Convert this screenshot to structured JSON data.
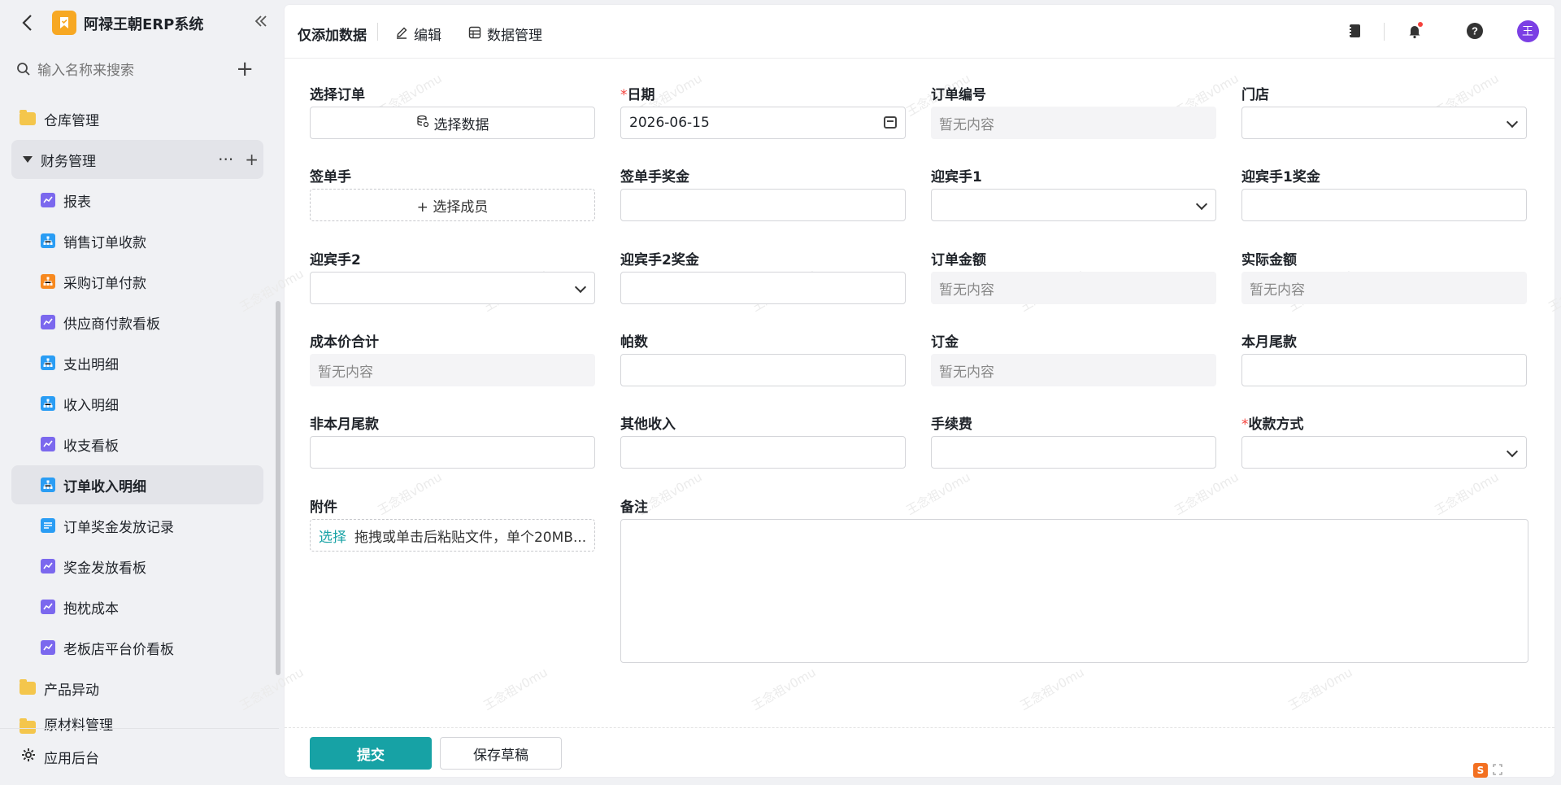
{
  "app": {
    "title": "阿禄王朝ERP系统"
  },
  "sidebar": {
    "search_placeholder": "输入名称来搜索",
    "items": [
      {
        "label": "仓库管理",
        "kind": "folder"
      },
      {
        "label": "财务管理",
        "kind": "group-open"
      },
      {
        "label": "报表",
        "kind": "chart"
      },
      {
        "label": "销售订单收款",
        "kind": "tree-blue"
      },
      {
        "label": "采购订单付款",
        "kind": "tree-orange"
      },
      {
        "label": "供应商付款看板",
        "kind": "chart"
      },
      {
        "label": "支出明细",
        "kind": "tree-blue"
      },
      {
        "label": "收入明细",
        "kind": "tree-blue"
      },
      {
        "label": "收支看板",
        "kind": "chart"
      },
      {
        "label": "订单收入明细",
        "kind": "tree-blue",
        "selected": true
      },
      {
        "label": "订单奖金发放记录",
        "kind": "list"
      },
      {
        "label": "奖金发放看板",
        "kind": "chart"
      },
      {
        "label": "抱枕成本",
        "kind": "chart"
      },
      {
        "label": "老板店平台价看板",
        "kind": "chart"
      },
      {
        "label": "产品异动",
        "kind": "folder"
      },
      {
        "label": "原材料管理",
        "kind": "folder"
      }
    ],
    "bottom_label": "应用后台"
  },
  "toolbar": {
    "title": "仅添加数据",
    "edit_label": "编辑",
    "data_manage_label": "数据管理",
    "avatar_text": "王"
  },
  "form": {
    "select_order": {
      "label": "选择订单",
      "button": "选择数据"
    },
    "date": {
      "label": "日期",
      "value": "2026-06-15"
    },
    "order_no": {
      "label": "订单编号",
      "value": "暂无内容"
    },
    "store": {
      "label": "门店"
    },
    "signer": {
      "label": "签单手",
      "button": "+ 选择成员"
    },
    "signer_bonus": {
      "label": "签单手奖金"
    },
    "greeter1": {
      "label": "迎宾手1"
    },
    "greeter1_bonus": {
      "label": "迎宾手1奖金"
    },
    "greeter2": {
      "label": "迎宾手2"
    },
    "greeter2_bonus": {
      "label": "迎宾手2奖金"
    },
    "order_amount": {
      "label": "订单金额",
      "value": "暂无内容"
    },
    "actual_amount": {
      "label": "实际金额",
      "value": "暂无内容"
    },
    "cost_total": {
      "label": "成本价合计",
      "value": "暂无内容"
    },
    "frames": {
      "label": "帕数"
    },
    "deposit": {
      "label": "订金",
      "value": "暂无内容"
    },
    "month_balance": {
      "label": "本月尾款"
    },
    "non_month_balance": {
      "label": "非本月尾款"
    },
    "other_income": {
      "label": "其他收入"
    },
    "fee": {
      "label": "手续费"
    },
    "pay_method": {
      "label": "收款方式"
    },
    "attachment": {
      "label": "附件",
      "select": "选择",
      "hint": "拖拽或单击后粘贴文件，单个20MB..."
    },
    "remark": {
      "label": "备注"
    }
  },
  "footer": {
    "submit": "提交",
    "draft": "保存草稿"
  },
  "watermark": "王念祖v0mu",
  "colors": {
    "accent": "#17a2a5",
    "logo": "#f7a823",
    "avatar": "#7b3fe4"
  }
}
